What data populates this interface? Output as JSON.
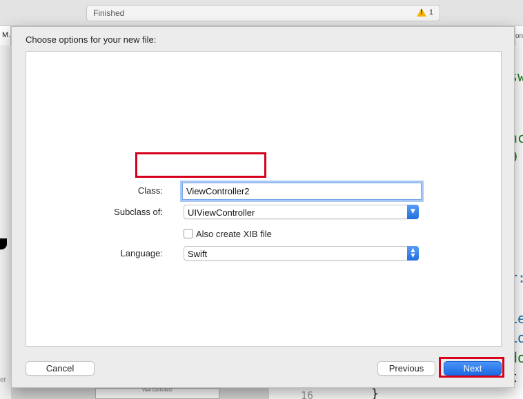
{
  "activity": {
    "status": "Finished",
    "warning_count": "1",
    "warning_icon": "warning-triangle-icon"
  },
  "tabs": {
    "left_fragment": "M...",
    "right_fragment": "on"
  },
  "sidebar": {
    "fragment": "er"
  },
  "code_fragments": {
    "l1": "sw",
    "l2": "nc",
    "l3": "9",
    "l4": "r:",
    "l5": "Le",
    "l6": "Lo",
    "l7": "do",
    "l8": " t",
    "line_number": "16",
    "brace": "}"
  },
  "storyboard": {
    "thumb_label": "View Controller2"
  },
  "dialog": {
    "title": "Choose options for your new file:",
    "class_label": "Class:",
    "class_value": "ViewController2",
    "subclass_label": "Subclass of:",
    "subclass_value": "UIViewController",
    "xib_label": "Also create XIB file",
    "xib_checked": false,
    "language_label": "Language:",
    "language_value": "Swift",
    "cancel_label": "Cancel",
    "previous_label": "Previous",
    "next_label": "Next"
  },
  "colors": {
    "accent": "#1b6ae3",
    "highlight": "#d6001c",
    "code_green": "#1e7a1e",
    "code_blue": "#1d6fa6"
  }
}
